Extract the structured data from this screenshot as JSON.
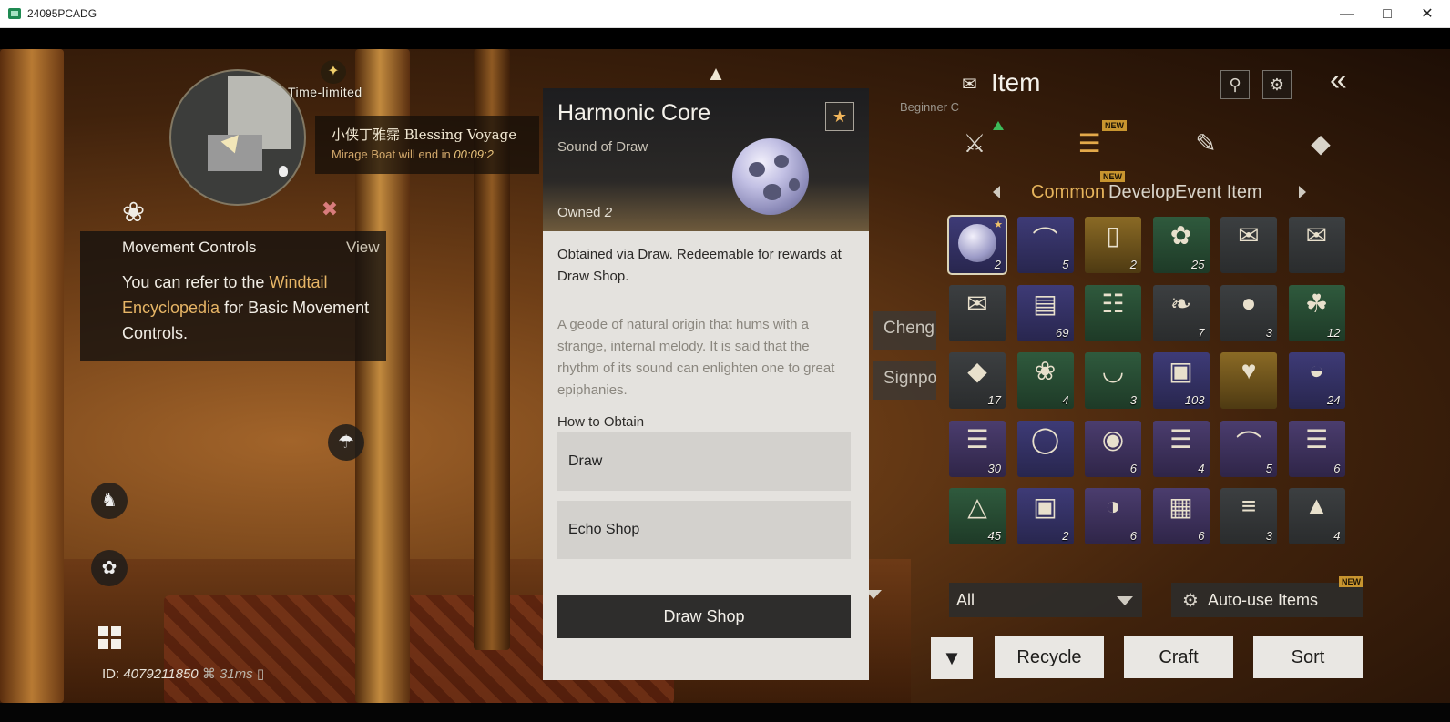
{
  "window": {
    "title": "24095PCADG"
  },
  "hud": {
    "time_limited": "Time-limited",
    "event_title": "小侠丁雅霈 Blessing Voyage",
    "event_sub_prefix": "Mirage Boat will end in",
    "event_timer": "00:09:2",
    "tip_heading": "Movement Controls",
    "tip_view": "View",
    "tip_body_1": "You can refer to the ",
    "tip_link": "Windtail Encyclopedia",
    "tip_body_2": " for Basic Movement Controls.",
    "status_id_label": "ID:",
    "status_id": "4079211850",
    "status_ping": "31ms",
    "chip_1": "Cheng Y",
    "chip_2": "Signpos",
    "beginner": "Beginner C"
  },
  "detail": {
    "name": "Harmonic Core",
    "subtitle": "Sound of Draw",
    "owned_label": "Owned",
    "owned_count": "2",
    "desc_main": "Obtained via Draw. Redeemable for rewards at Draw Shop.",
    "desc_flavor": "A geode of natural origin that hums with a strange, internal melody. It is said that the rhythm of its sound can enlighten one to great epiphanies.",
    "how_to_obtain": "How to Obtain",
    "sources": [
      "Draw",
      "Echo Shop"
    ],
    "action": "Draw Shop"
  },
  "inventory": {
    "title": "Item",
    "new_badge": "NEW",
    "subtabs": [
      "Common",
      "Develop",
      "Event Item"
    ],
    "active_subtab": "Common",
    "items": [
      {
        "icon": "orb-icon",
        "qty": "2",
        "rarity": "rare",
        "selected": true,
        "fav": true
      },
      {
        "icon": "horn-icon",
        "qty": "5",
        "rarity": "rare"
      },
      {
        "icon": "scroll-red-icon",
        "qty": "2",
        "rarity": "legend"
      },
      {
        "icon": "blossom-icon",
        "qty": "25",
        "rarity": "uncommon"
      },
      {
        "icon": "envelope-icon",
        "qty": "",
        "rarity": "common"
      },
      {
        "icon": "envelope-icon",
        "qty": "",
        "rarity": "common"
      },
      {
        "icon": "letter-icon",
        "qty": "",
        "rarity": "common"
      },
      {
        "icon": "chest-purple-icon",
        "qty": "69",
        "rarity": "rare"
      },
      {
        "icon": "paper-icon",
        "qty": "",
        "rarity": "uncommon"
      },
      {
        "icon": "feather-icon",
        "qty": "7",
        "rarity": "common"
      },
      {
        "icon": "meat-icon",
        "qty": "3",
        "rarity": "common"
      },
      {
        "icon": "herb-icon",
        "qty": "12",
        "rarity": "uncommon"
      },
      {
        "icon": "ore-icon",
        "qty": "17",
        "rarity": "common"
      },
      {
        "icon": "lavender-icon",
        "qty": "4",
        "rarity": "uncommon"
      },
      {
        "icon": "bowl-icon",
        "qty": "3",
        "rarity": "uncommon"
      },
      {
        "icon": "chest-icon",
        "qty": "103",
        "rarity": "rare"
      },
      {
        "icon": "gift-box-icon",
        "qty": "",
        "rarity": "legend"
      },
      {
        "icon": "stew-icon",
        "qty": "24",
        "rarity": "rare"
      },
      {
        "icon": "map-scroll-icon",
        "qty": "30",
        "rarity": "epic"
      },
      {
        "icon": "jar-icon",
        "qty": "",
        "rarity": "rare"
      },
      {
        "icon": "food-icon",
        "qty": "6",
        "rarity": "epic"
      },
      {
        "icon": "map-scroll-icon",
        "qty": "4",
        "rarity": "epic"
      },
      {
        "icon": "horn-icon",
        "qty": "5",
        "rarity": "epic"
      },
      {
        "icon": "map-scroll-icon",
        "qty": "6",
        "rarity": "epic"
      },
      {
        "icon": "pouch-icon",
        "qty": "45",
        "rarity": "uncommon"
      },
      {
        "icon": "chest-icon",
        "qty": "2",
        "rarity": "rare"
      },
      {
        "icon": "dish-icon",
        "qty": "6",
        "rarity": "epic"
      },
      {
        "icon": "wooden-chest-icon",
        "qty": "6",
        "rarity": "epic"
      },
      {
        "icon": "wood-icon",
        "qty": "3",
        "rarity": "common"
      },
      {
        "icon": "sack-icon",
        "qty": "4",
        "rarity": "common"
      }
    ],
    "filter": "All",
    "auto_use": "Auto-use Items",
    "buttons": [
      "Recycle",
      "Craft",
      "Sort"
    ]
  },
  "colors": {
    "accent": "#e6b45c",
    "panel": "#e4e2de",
    "dark_button": "#2e2d2c"
  }
}
